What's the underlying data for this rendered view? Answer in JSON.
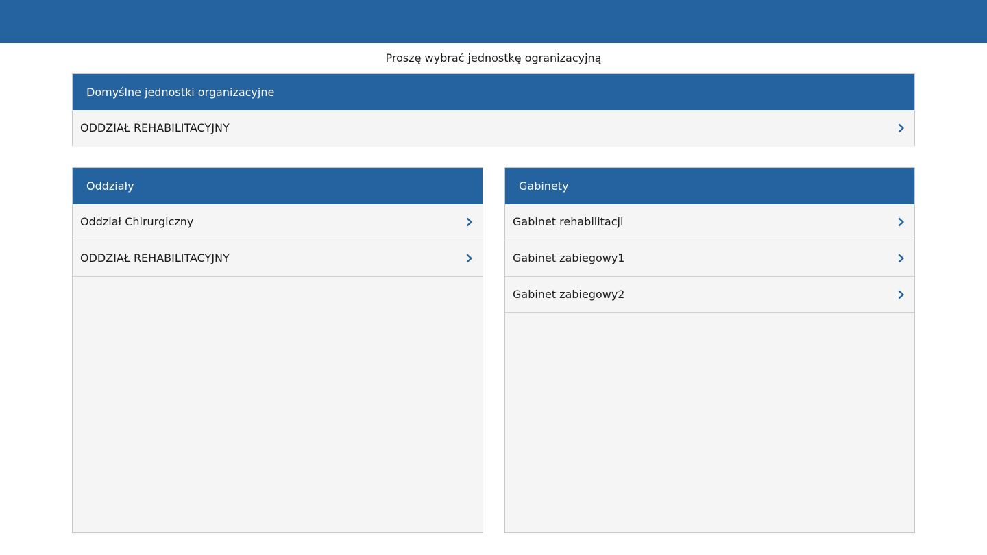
{
  "header": {
    "prompt": "Proszę wybrać jednostkę ogranizacyjną"
  },
  "default_units": {
    "title": "Domyślne jednostki organizacyjne",
    "items": [
      {
        "label": "ODDZIAŁ REHABILITACYJNY",
        "icon": "chevron-right-icon"
      }
    ]
  },
  "wards": {
    "title": "Oddziały",
    "items": [
      {
        "label": "Oddział Chirurgiczny",
        "icon": "chevron-right-icon"
      },
      {
        "label": "ODDZIAŁ REHABILITACYJNY",
        "icon": "chevron-right-icon"
      }
    ]
  },
  "offices": {
    "title": "Gabinety",
    "items": [
      {
        "label": "Gabinet rehabilitacji",
        "icon": "chevron-right-icon"
      },
      {
        "label": "Gabinet zabiegowy1",
        "icon": "chevron-right-icon"
      },
      {
        "label": "Gabinet zabiegowy2",
        "icon": "chevron-right-icon"
      }
    ]
  },
  "colors": {
    "brand": "#2563a0",
    "panel_background": "#f5f5f5",
    "border": "#c8c8c8",
    "chevron": "#2563a0"
  }
}
